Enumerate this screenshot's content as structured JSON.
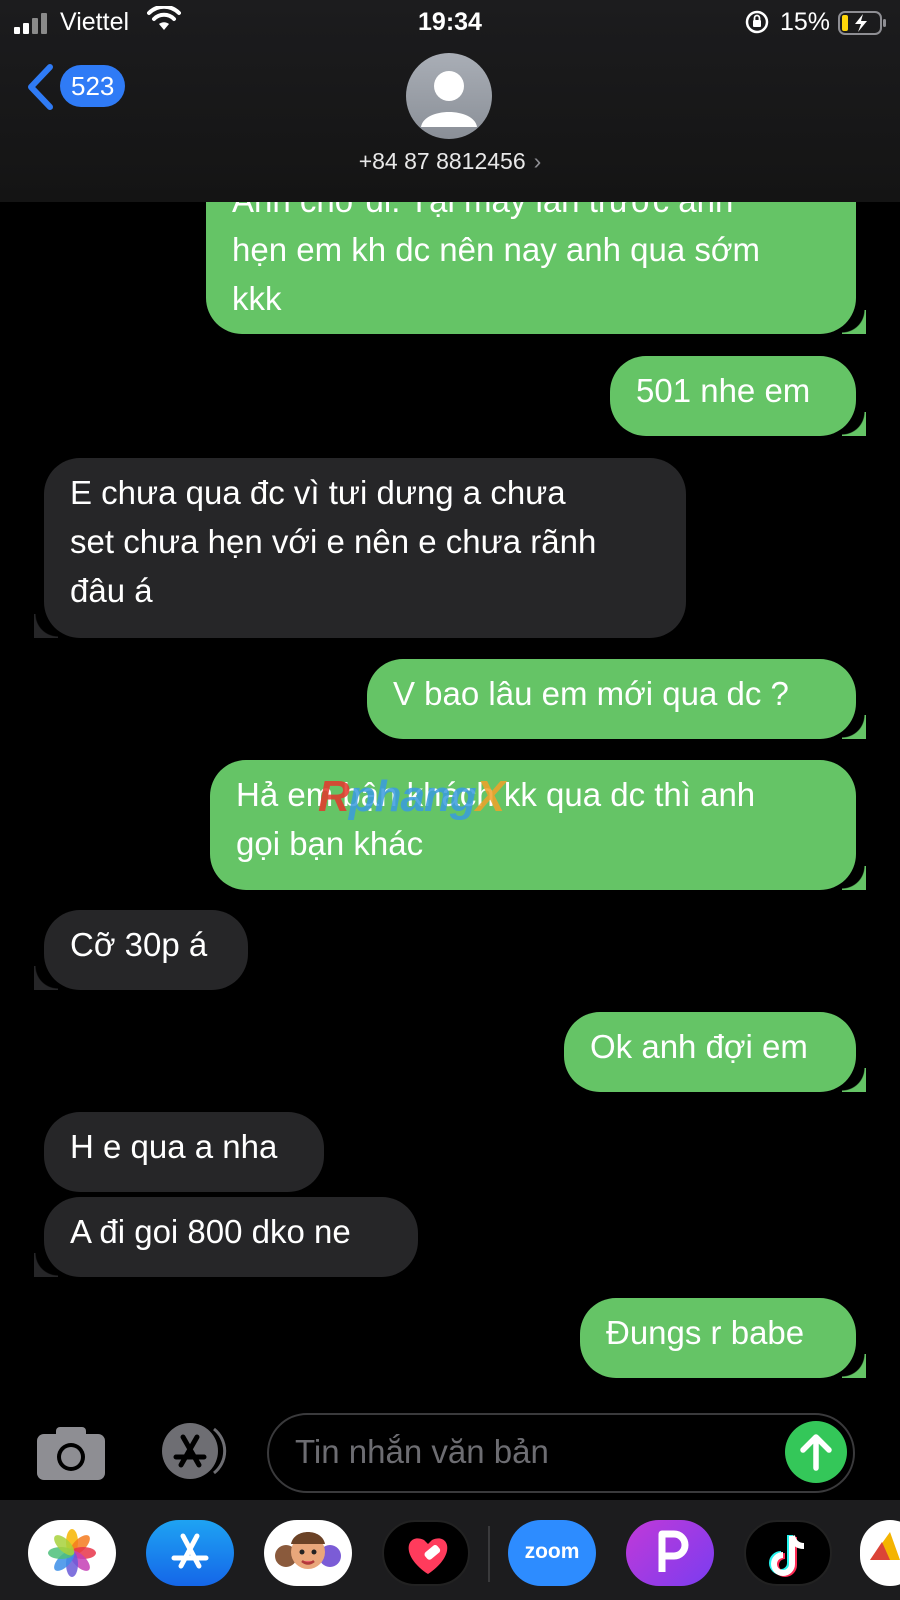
{
  "status_bar": {
    "carrier": "Viettel",
    "time": "19:34",
    "battery_percent": "15%"
  },
  "header": {
    "back_count": "523",
    "contact_number": "+84 87 8812456",
    "chevron": "›"
  },
  "messages": [
    {
      "dir": "out",
      "text": "Anh chờ đi. Tại mấy lần trước anh\nhẹn em kh dc nên nay anh qua sớm\nkkk"
    },
    {
      "dir": "out",
      "text": "501 nhe em"
    },
    {
      "dir": "in",
      "text": "E chưa qua đc vì tưi dưng a chưa\nset chưa hẹn với e nên e chưa rãnh\nđâu á"
    },
    {
      "dir": "out",
      "text": "V bao lâu em mới qua dc ?"
    },
    {
      "dir": "out",
      "text": "Hả em bận khách kk qua dc thì anh\ngọi bạn khác"
    },
    {
      "dir": "in",
      "text": "Cỡ 30p á"
    },
    {
      "dir": "out",
      "text": "Ok anh đợi em"
    },
    {
      "dir": "in",
      "text": "H e qua a nha"
    },
    {
      "dir": "in",
      "text": "A đi goi 800 dko ne"
    },
    {
      "dir": "out",
      "text": "Đungs r babe"
    }
  ],
  "watermark": {
    "part1": "R",
    "part2": "phang",
    "part3": "X"
  },
  "input": {
    "placeholder": "Tin nhắn văn bản"
  },
  "dock": {
    "zoom_label": "zoom"
  },
  "colors": {
    "outgoing_bubble": "#65c466",
    "incoming_bubble": "#262628",
    "badge": "#2f7bf6",
    "send_button": "#34c759"
  },
  "icons": [
    "signal-icon",
    "wifi-icon",
    "orientation-lock-icon",
    "battery-charging-icon",
    "back-chevron-icon",
    "contact-avatar-icon",
    "camera-icon",
    "app-store-icon",
    "send-arrow-icon",
    "photos-app-icon",
    "app-store-app-icon",
    "memoji-app-icon",
    "health-heart-app-icon",
    "zoom-app-icon",
    "picsart-app-icon",
    "tiktok-app-icon"
  ]
}
